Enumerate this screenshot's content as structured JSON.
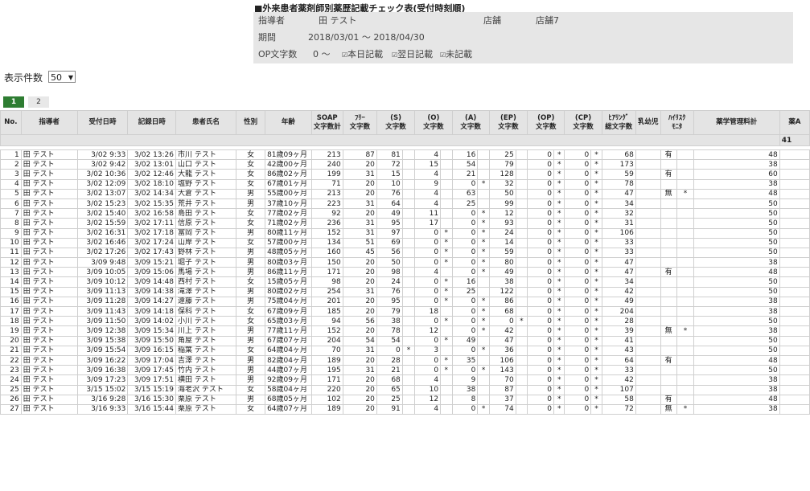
{
  "report": {
    "title": "■外来患者薬剤師別薬歴記載チェック表(受付時刻順)",
    "instructor_label": "指導者",
    "instructor_value": "田 テスト",
    "store_label": "店舗",
    "store_value": "店舗7",
    "period_label": "期間",
    "period_value": "2018/03/01 ～ 2018/04/30",
    "op_label": "OP文字数",
    "op_value": "0 ～",
    "checks": [
      "本日記載",
      "翌日記載",
      "未記載"
    ]
  },
  "display": {
    "count_label": "表示件数",
    "count_value": "50"
  },
  "pager": [
    "1",
    "2"
  ],
  "headers": {
    "no": "No.",
    "instructor": "指導者",
    "received": "受付日時",
    "recorded": "記録日時",
    "patient": "患者氏名",
    "sex": "性別",
    "age": "年齢",
    "soap1": "SOAP",
    "soap2": "文字数計",
    "free1": "ﾌﾘｰ",
    "free2": "文字数",
    "s1": "(S)",
    "s2": "文字数",
    "o1": "(O)",
    "o2": "文字数",
    "a1": "(A)",
    "a2": "文字数",
    "ep1": "(EP)",
    "ep2": "文字数",
    "op1": "(OP)",
    "op2": "文字数",
    "cp1": "(CP)",
    "cp2": "文字数",
    "hear1": "ﾋｱﾘﾝｸﾞ",
    "hear2": "総文字数",
    "infant": "乳幼児",
    "hr1": "ﾊｲﾘｽｸ",
    "hr2": "ﾓﾆﾀ",
    "fee": "薬学管理料計",
    "drug": "薬A"
  },
  "summary": {
    "drug": "41"
  },
  "rows": [
    [
      "1",
      "田 テスト",
      "3/02 9:33",
      "3/02 13:26",
      "市川 テスト",
      "女",
      "81歳09ヶ月",
      "213",
      "87",
      "81",
      "",
      "4",
      "",
      "16",
      "",
      "25",
      "",
      "0",
      "*",
      "0",
      "*",
      "68",
      "",
      "有",
      "",
      "48"
    ],
    [
      "2",
      "田 テスト",
      "3/02 9:42",
      "3/02 13:01",
      "山口 テスト",
      "女",
      "42歳00ヶ月",
      "240",
      "20",
      "72",
      "",
      "15",
      "",
      "54",
      "",
      "79",
      "",
      "0",
      "*",
      "0",
      "*",
      "173",
      "",
      "",
      "",
      "38"
    ],
    [
      "3",
      "田 テスト",
      "3/02 10:36",
      "3/02 12:46",
      "大龍 テスト",
      "女",
      "86歳02ヶ月",
      "199",
      "31",
      "15",
      "",
      "4",
      "",
      "21",
      "",
      "128",
      "",
      "0",
      "*",
      "0",
      "*",
      "59",
      "",
      "有",
      "",
      "60"
    ],
    [
      "4",
      "田 テスト",
      "3/02 12:09",
      "3/02 18:10",
      "塩野 テスト",
      "女",
      "67歳01ヶ月",
      "71",
      "20",
      "10",
      "",
      "9",
      "",
      "0",
      "*",
      "32",
      "",
      "0",
      "*",
      "0",
      "*",
      "78",
      "",
      "",
      "",
      "38"
    ],
    [
      "5",
      "田 テスト",
      "3/02 13:07",
      "3/02 14:34",
      "大倉 テスト",
      "男",
      "55歳00ヶ月",
      "213",
      "20",
      "76",
      "",
      "4",
      "",
      "63",
      "",
      "50",
      "",
      "0",
      "*",
      "0",
      "*",
      "47",
      "",
      "無",
      "*",
      "48"
    ],
    [
      "6",
      "田 テスト",
      "3/02 15:23",
      "3/02 15:35",
      "荒井 テスト",
      "男",
      "37歳10ヶ月",
      "223",
      "31",
      "64",
      "",
      "4",
      "",
      "25",
      "",
      "99",
      "",
      "0",
      "*",
      "0",
      "*",
      "34",
      "",
      "",
      "",
      "50"
    ],
    [
      "7",
      "田 テスト",
      "3/02 15:40",
      "3/02 16:58",
      "島田 テスト",
      "女",
      "77歳02ヶ月",
      "92",
      "20",
      "49",
      "",
      "11",
      "",
      "0",
      "*",
      "12",
      "",
      "0",
      "*",
      "0",
      "*",
      "32",
      "",
      "",
      "",
      "50"
    ],
    [
      "8",
      "田 テスト",
      "3/02 15:59",
      "3/02 17:11",
      "信原 テスト",
      "女",
      "71歳02ヶ月",
      "236",
      "31",
      "95",
      "",
      "17",
      "",
      "0",
      "*",
      "93",
      "",
      "0",
      "*",
      "0",
      "*",
      "31",
      "",
      "",
      "",
      "50"
    ],
    [
      "9",
      "田 テスト",
      "3/02 16:31",
      "3/02 17:18",
      "富岡 テスト",
      "男",
      "80歳11ヶ月",
      "152",
      "31",
      "97",
      "",
      "0",
      "*",
      "0",
      "*",
      "24",
      "",
      "0",
      "*",
      "0",
      "*",
      "106",
      "",
      "",
      "",
      "50"
    ],
    [
      "10",
      "田 テスト",
      "3/02 16:46",
      "3/02 17:24",
      "山岸 テスト",
      "女",
      "57歳00ヶ月",
      "134",
      "51",
      "69",
      "",
      "0",
      "*",
      "0",
      "*",
      "14",
      "",
      "0",
      "*",
      "0",
      "*",
      "33",
      "",
      "",
      "",
      "50"
    ],
    [
      "11",
      "田 テスト",
      "3/02 17:26",
      "3/02 17:43",
      "野林 テスト",
      "男",
      "48歳05ヶ月",
      "160",
      "45",
      "56",
      "",
      "0",
      "*",
      "0",
      "*",
      "59",
      "",
      "0",
      "*",
      "0",
      "*",
      "33",
      "",
      "",
      "",
      "50"
    ],
    [
      "12",
      "田 テスト",
      "3/09 9:48",
      "3/09 15:21",
      "堀子 テスト",
      "男",
      "80歳03ヶ月",
      "150",
      "20",
      "50",
      "",
      "0",
      "*",
      "0",
      "*",
      "80",
      "",
      "0",
      "*",
      "0",
      "*",
      "47",
      "",
      "",
      "",
      "38"
    ],
    [
      "13",
      "田 テスト",
      "3/09 10:05",
      "3/09 15:06",
      "馬場 テスト",
      "男",
      "86歳11ヶ月",
      "171",
      "20",
      "98",
      "",
      "4",
      "",
      "0",
      "*",
      "49",
      "",
      "0",
      "*",
      "0",
      "*",
      "47",
      "",
      "有",
      "",
      "48"
    ],
    [
      "14",
      "田 テスト",
      "3/09 10:12",
      "3/09 14:48",
      "西村 テスト",
      "女",
      "15歳05ヶ月",
      "98",
      "20",
      "24",
      "",
      "0",
      "*",
      "16",
      "",
      "38",
      "",
      "0",
      "*",
      "0",
      "*",
      "34",
      "",
      "",
      "",
      "50"
    ],
    [
      "15",
      "田 テスト",
      "3/09 11:13",
      "3/09 14:38",
      "滝澤 テスト",
      "男",
      "80歳02ヶ月",
      "254",
      "31",
      "76",
      "",
      "0",
      "*",
      "25",
      "",
      "122",
      "",
      "0",
      "*",
      "0",
      "*",
      "42",
      "",
      "",
      "",
      "50"
    ],
    [
      "16",
      "田 テスト",
      "3/09 11:28",
      "3/09 14:27",
      "遠藤 テスト",
      "男",
      "75歳04ヶ月",
      "201",
      "20",
      "95",
      "",
      "0",
      "*",
      "0",
      "*",
      "86",
      "",
      "0",
      "*",
      "0",
      "*",
      "49",
      "",
      "",
      "",
      "38"
    ],
    [
      "17",
      "田 テスト",
      "3/09 11:43",
      "3/09 14:18",
      "保科 テスト",
      "女",
      "67歳09ヶ月",
      "185",
      "20",
      "79",
      "",
      "18",
      "",
      "0",
      "*",
      "68",
      "",
      "0",
      "*",
      "0",
      "*",
      "204",
      "",
      "",
      "",
      "38"
    ],
    [
      "18",
      "田 テスト",
      "3/09 11:50",
      "3/09 14:02",
      "小川 テスト",
      "女",
      "65歳03ヶ月",
      "94",
      "56",
      "38",
      "",
      "0",
      "*",
      "0",
      "*",
      "0",
      "*",
      "0",
      "*",
      "0",
      "*",
      "28",
      "",
      "",
      "",
      "50"
    ],
    [
      "19",
      "田 テスト",
      "3/09 12:38",
      "3/09 15:34",
      "川上 テスト",
      "男",
      "77歳11ヶ月",
      "152",
      "20",
      "78",
      "",
      "12",
      "",
      "0",
      "*",
      "42",
      "",
      "0",
      "*",
      "0",
      "*",
      "39",
      "",
      "無",
      "*",
      "38"
    ],
    [
      "20",
      "田 テスト",
      "3/09 15:38",
      "3/09 15:50",
      "角屋 テスト",
      "男",
      "67歳07ヶ月",
      "204",
      "54",
      "54",
      "",
      "0",
      "*",
      "49",
      "",
      "47",
      "",
      "0",
      "*",
      "0",
      "*",
      "41",
      "",
      "",
      "",
      "50"
    ],
    [
      "21",
      "田 テスト",
      "3/09 15:54",
      "3/09 16:15",
      "稲葉 テスト",
      "女",
      "64歳04ヶ月",
      "70",
      "31",
      "0",
      "*",
      "3",
      "",
      "0",
      "*",
      "36",
      "",
      "0",
      "*",
      "0",
      "*",
      "43",
      "",
      "",
      "",
      "50"
    ],
    [
      "22",
      "田 テスト",
      "3/09 16:22",
      "3/09 17:04",
      "吉澤 テスト",
      "男",
      "82歳04ヶ月",
      "189",
      "20",
      "28",
      "",
      "0",
      "*",
      "35",
      "",
      "106",
      "",
      "0",
      "*",
      "0",
      "*",
      "64",
      "",
      "有",
      "",
      "48"
    ],
    [
      "23",
      "田 テスト",
      "3/09 16:38",
      "3/09 17:45",
      "竹内 テスト",
      "男",
      "44歳07ヶ月",
      "195",
      "31",
      "21",
      "",
      "0",
      "*",
      "0",
      "*",
      "143",
      "",
      "0",
      "*",
      "0",
      "*",
      "33",
      "",
      "",
      "",
      "50"
    ],
    [
      "24",
      "田 テスト",
      "3/09 17:23",
      "3/09 17:51",
      "横田 テスト",
      "男",
      "92歳09ヶ月",
      "171",
      "20",
      "68",
      "",
      "4",
      "",
      "9",
      "",
      "70",
      "",
      "0",
      "*",
      "0",
      "*",
      "42",
      "",
      "",
      "",
      "38"
    ],
    [
      "25",
      "田 テスト",
      "3/15 15:02",
      "3/15 15:19",
      "海老沢 テスト",
      "女",
      "58歳04ヶ月",
      "220",
      "20",
      "65",
      "",
      "10",
      "",
      "38",
      "",
      "87",
      "",
      "0",
      "*",
      "0",
      "*",
      "107",
      "",
      "",
      "",
      "38"
    ],
    [
      "26",
      "田 テスト",
      "3/16 9:28",
      "3/16 15:30",
      "栗原 テスト",
      "男",
      "68歳05ヶ月",
      "102",
      "20",
      "25",
      "",
      "12",
      "",
      "8",
      "",
      "37",
      "",
      "0",
      "*",
      "0",
      "*",
      "58",
      "",
      "有",
      "",
      "48"
    ],
    [
      "27",
      "田 テスト",
      "3/16 9:33",
      "3/16 15:44",
      "栗原 テスト",
      "女",
      "64歳07ヶ月",
      "189",
      "20",
      "91",
      "",
      "4",
      "",
      "0",
      "*",
      "74",
      "",
      "0",
      "*",
      "0",
      "*",
      "72",
      "",
      "無",
      "*",
      "38"
    ]
  ]
}
